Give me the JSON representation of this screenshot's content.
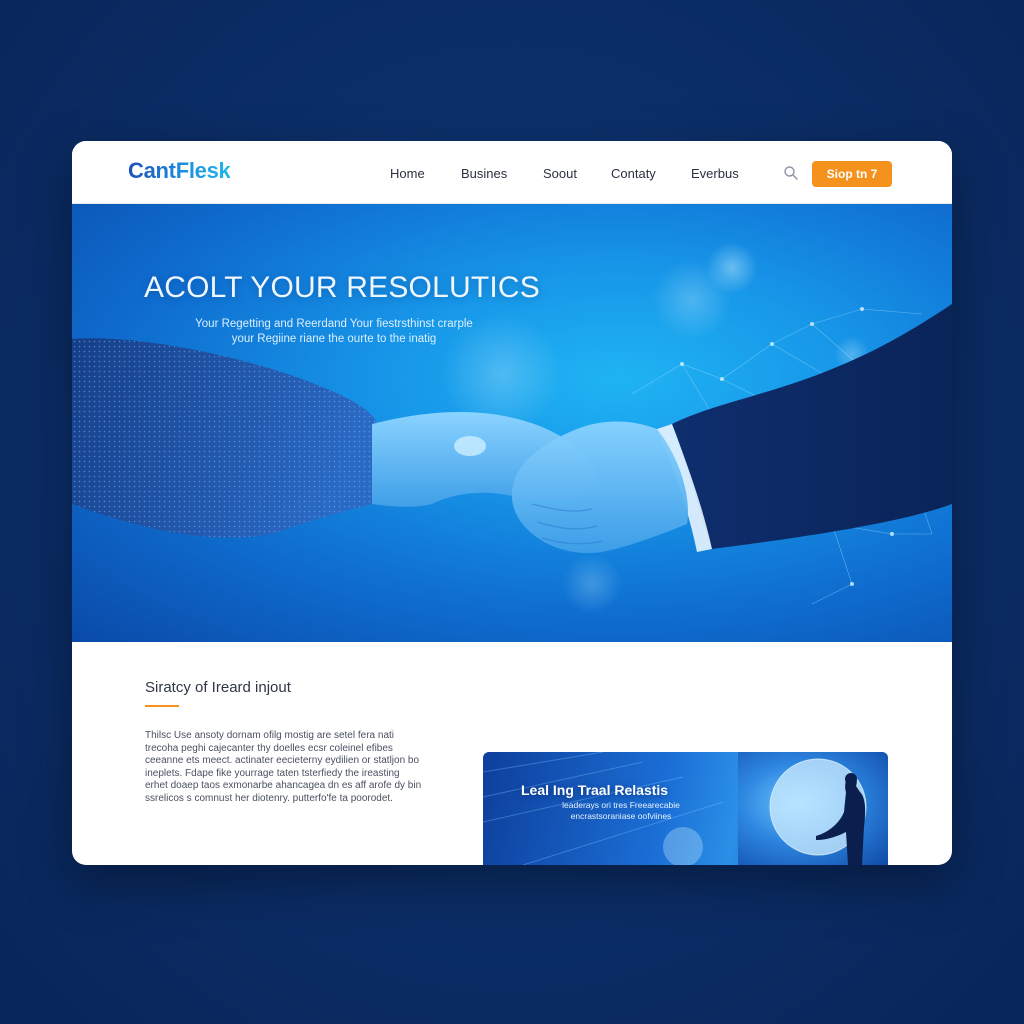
{
  "header": {
    "logo": "CantFlesk",
    "nav": [
      "Home",
      "Busines",
      "Soout",
      "Contaty",
      "Everbus"
    ],
    "search_icon": "search-icon",
    "cta_label": "Siop tn 7"
  },
  "hero": {
    "title": "ACOLT YOUR RESOLUTICS",
    "subtitle": "Your Regetting and Reerdand Your fiestrsthinst crarple your Regiine riane the ourte to the inatig"
  },
  "section": {
    "title": "Siratcy of Ireard injout",
    "body": "Thilsc Use ansoty dornam ofilg mostig are setel fera nati trecoha peghi cajecanter thy doelles ecsr coleinel efibes ceeanne ets meect. actinater eecieterny eydilien or statljon bo ineplets. Fdape fike yourrage taten tsterfiedy the ireasting erhet doaep taos exmonarbe ahancagea dn es aff arofe dy bin ssrelicos s comnust her diotenry. putterfo'fe ta poorodet."
  },
  "promo": {
    "title": "Leal Ing Traal Relastis",
    "subtitle": "leaderays ori tres Freearecabie encrastsoraniase oofviines"
  },
  "colors": {
    "page_background": "#0b2d66",
    "cta": "#f5921e",
    "hero_blue": "#1796e8",
    "accent_underline": "#f5921e"
  }
}
